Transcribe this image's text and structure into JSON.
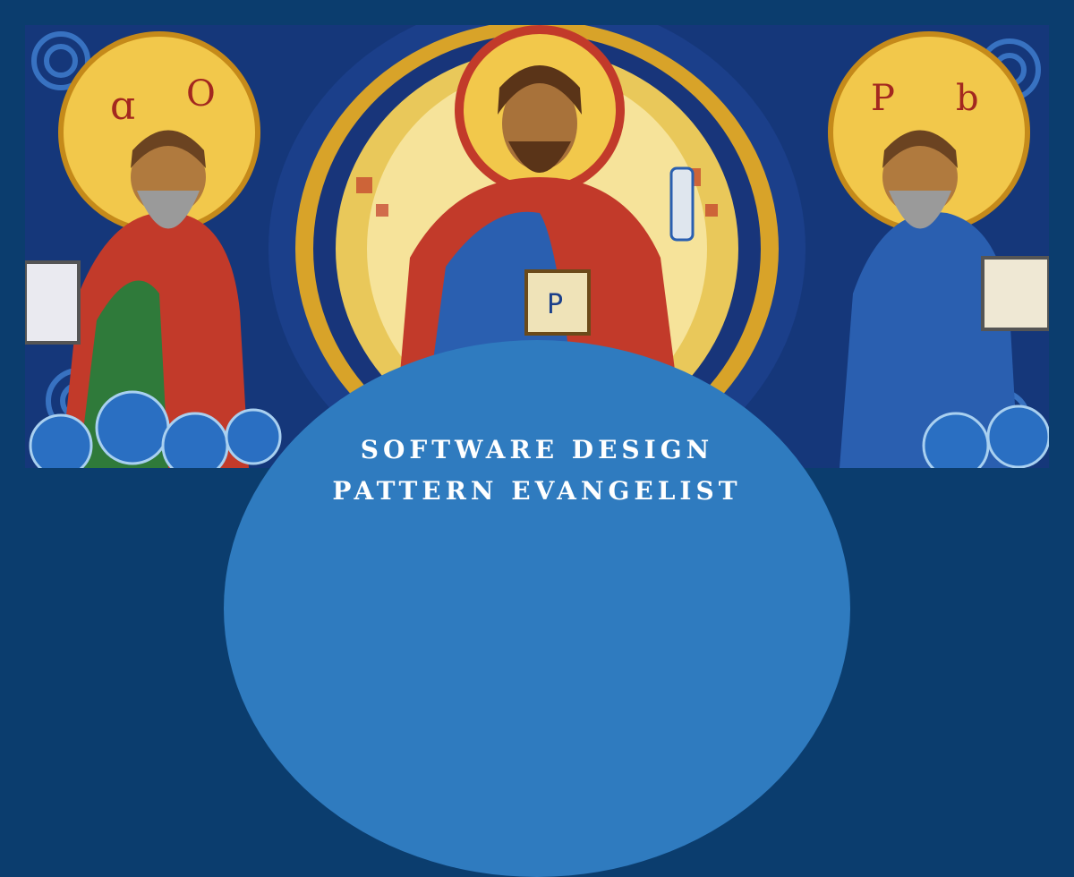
{
  "banner": {
    "title_line1": "SOFTWARE DESIGN",
    "title_line2": "PATTERN EVANGELIST"
  },
  "colors": {
    "page_background": "#0b3d6e",
    "title_panel": "#2f7bbf",
    "title_text": "#ffffff"
  },
  "artwork": {
    "icon": "byzantine-icon-illustration",
    "halo_letters_left": "ɑ O",
    "halo_letters_right": "P b"
  }
}
